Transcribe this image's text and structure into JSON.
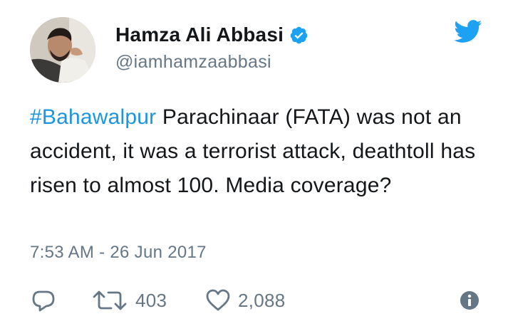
{
  "user": {
    "display_name": "Hamza Ali Abbasi",
    "handle": "@iamhamzaabbasi",
    "verified": true
  },
  "tweet": {
    "hashtag": "#Bahawalpur",
    "text": " Parachinaar (FATA) was not an accident, it was a terrorist attack, deathtoll has risen to almost 100. Media coverage?",
    "timestamp": "7:53 AM - 26 Jun 2017"
  },
  "actions": {
    "retweet_count": "403",
    "like_count": "2,088"
  },
  "icons": {
    "brand": "twitter-bird-icon",
    "verified": "verified-badge-icon",
    "reply": "reply-icon",
    "retweet": "retweet-icon",
    "like": "heart-icon",
    "info": "info-icon"
  },
  "colors": {
    "brand_blue": "#1da1f2",
    "hashtag_blue": "#1b95e0",
    "secondary_text": "#657786",
    "primary_text": "#14171a"
  }
}
